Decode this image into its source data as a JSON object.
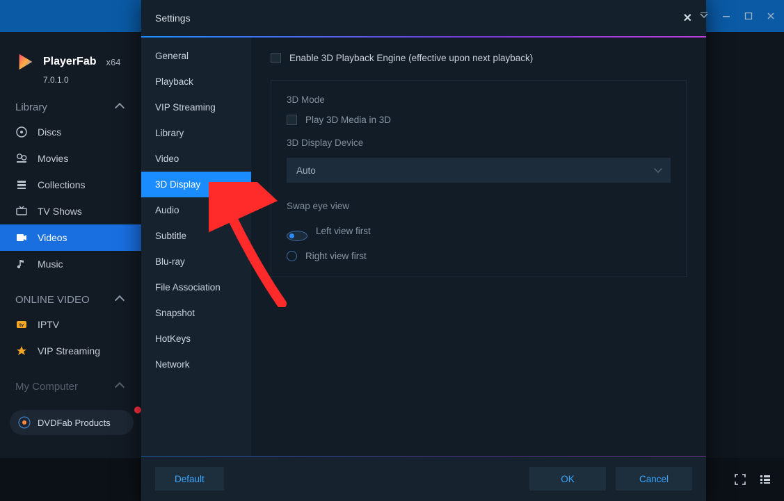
{
  "app": {
    "brand_name": "PlayerFab",
    "brand_arch": "x64",
    "brand_version": "7.0.1.0"
  },
  "sidebar": {
    "sections": [
      {
        "title": "Library",
        "items": [
          {
            "label": "Discs",
            "icon": "disc-icon"
          },
          {
            "label": "Movies",
            "icon": "film-icon"
          },
          {
            "label": "Collections",
            "icon": "collection-icon"
          },
          {
            "label": "TV Shows",
            "icon": "tv-icon"
          },
          {
            "label": "Videos",
            "icon": "video-icon",
            "selected": true
          },
          {
            "label": "Music",
            "icon": "music-icon"
          }
        ]
      },
      {
        "title": "ONLINE VIDEO",
        "items": [
          {
            "label": "IPTV",
            "icon": "iptv-icon"
          },
          {
            "label": "VIP Streaming",
            "icon": "vip-icon"
          }
        ]
      },
      {
        "title": "My Computer",
        "items": []
      }
    ],
    "dvdfab_label": "DVDFab Products"
  },
  "settings_dialog": {
    "title": "Settings",
    "nav": [
      "General",
      "Playback",
      "VIP Streaming",
      "Library",
      "Video",
      "3D Display",
      "Audio",
      "Subtitle",
      "Blu-ray",
      "File Association",
      "Snapshot",
      "HotKeys",
      "Network"
    ],
    "nav_selected": "3D Display",
    "content": {
      "enable_label": "Enable 3D Playback Engine (effective upon next playback)",
      "mode_label": "3D Mode",
      "play3d_label": "Play 3D Media in 3D",
      "device_label": "3D Display Device",
      "device_value": "Auto",
      "swap_label": "Swap eye view",
      "radio_left": "Left view first",
      "radio_right": "Right view first",
      "radio_selected": "left"
    },
    "buttons": {
      "default": "Default",
      "ok": "OK",
      "cancel": "Cancel"
    }
  }
}
